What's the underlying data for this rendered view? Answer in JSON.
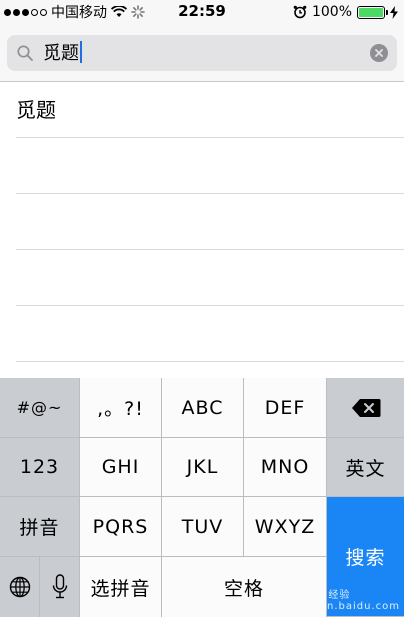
{
  "status_bar": {
    "carrier": "中国移动",
    "time": "22:59",
    "battery_percent": "100%",
    "battery_level": 1.0,
    "battery_color": "#4cd964"
  },
  "search": {
    "value": "觅题",
    "icon": "search-icon",
    "clear_icon": "clear-icon"
  },
  "suggestions": [
    "觅题",
    "",
    "",
    "",
    ""
  ],
  "keyboard": {
    "row1": [
      "#@~",
      ",。?!",
      "ABC",
      "DEF",
      "delete-icon"
    ],
    "row2": [
      "123",
      "GHI",
      "JKL",
      "MNO",
      "英文"
    ],
    "row3": [
      "拼音",
      "PQRS",
      "TUV",
      "WXYZ"
    ],
    "row4": [
      "globe-icon",
      "mic-icon",
      "选拼音",
      "空格"
    ],
    "search_label": "搜索",
    "accent_color": "#1a86f5"
  },
  "watermark": "Baidu 经验  jingyan.baidu.com"
}
